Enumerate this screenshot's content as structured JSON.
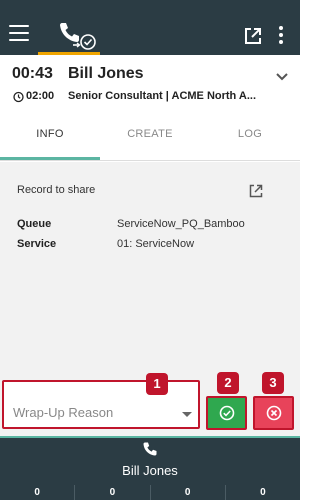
{
  "topbar": {
    "icons": [
      "menu-icon",
      "phone-check-icon",
      "popout-icon",
      "kebab-icon"
    ],
    "accent": "#f0a500"
  },
  "interaction": {
    "timer": "00:43",
    "name": "Bill Jones",
    "sub_time": "02:00",
    "subtitle": "Senior Consultant | ACME North A..."
  },
  "tabs": [
    "INFO",
    "CREATE",
    "LOG"
  ],
  "info": {
    "record_label": "Record to share",
    "queue_label": "Queue",
    "queue_value": "ServiceNow_PQ_Bamboo",
    "service_label": "Service",
    "service_value": "01: ServiceNow"
  },
  "wrapup": {
    "placeholder": "Wrap-Up Reason",
    "badges": [
      "1",
      "2",
      "3"
    ],
    "ok_color": "#2fa84f",
    "cancel_color": "#e8435a"
  },
  "bottom": {
    "name": "Bill Jones",
    "counts": [
      "0",
      "0",
      "0",
      "0"
    ]
  }
}
